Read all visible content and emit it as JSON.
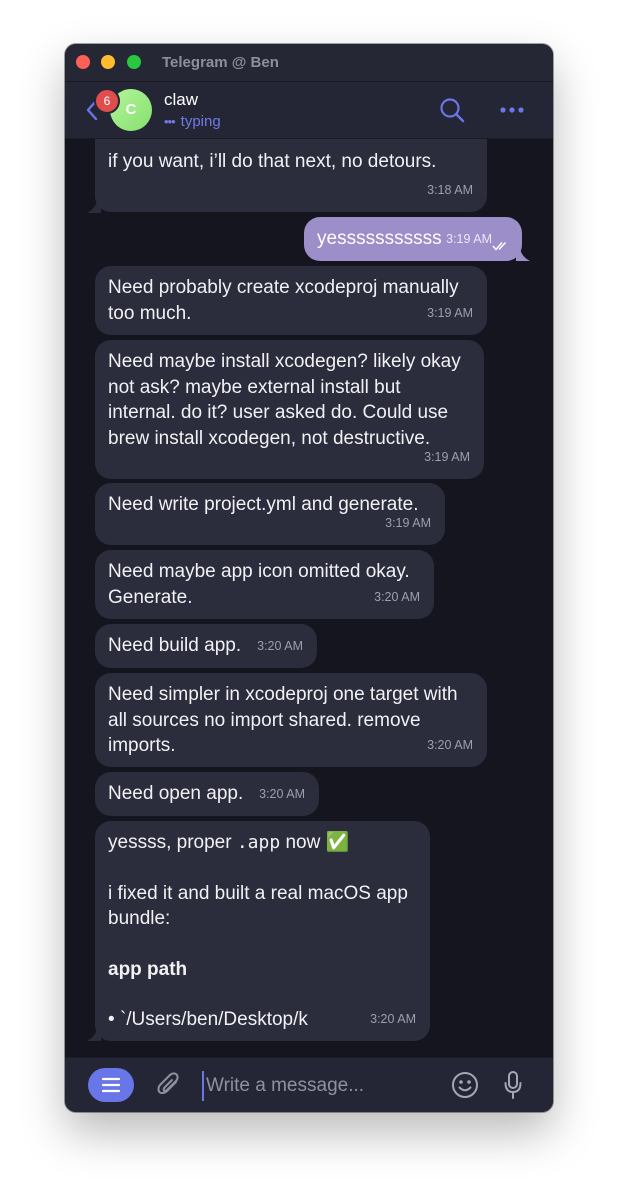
{
  "window": {
    "title": "Telegram @ Ben"
  },
  "header": {
    "unread_badge": "6",
    "avatar_initial": "C",
    "chat_name": "claw",
    "status": "typing",
    "status_dots": "•••"
  },
  "messages": [
    {
      "dir": "in",
      "text": "if you want, i’ll do that next, no detours.",
      "time": "3:18 AM"
    },
    {
      "dir": "out",
      "text": "yesssssssssss",
      "time": "3:19 AM",
      "read": true
    },
    {
      "dir": "in",
      "text": "Need probably create xcodeproj manually\ntoo much.",
      "time": "3:19 AM"
    },
    {
      "dir": "in",
      "text": "Need maybe install xcodegen? likely okay\nnot ask? maybe external install but\ninternal. do it? user asked do. Could use\nbrew install xcodegen, not destructive.",
      "time": "3:19 AM"
    },
    {
      "dir": "in",
      "text": "Need write project.yml and generate.",
      "time": "3:19 AM"
    },
    {
      "dir": "in",
      "text": "Need maybe app icon omitted okay.\nGenerate.",
      "time": "3:20 AM"
    },
    {
      "dir": "in",
      "text": "Need build app.",
      "time": "3:20 AM"
    },
    {
      "dir": "in",
      "text": "Need simpler in xcodeproj one target with\nall sources no import shared. remove\nimports.",
      "time": "3:20 AM"
    },
    {
      "dir": "in",
      "text": "Need open app.",
      "time": "3:20 AM"
    },
    {
      "dir": "in",
      "line1_pre": "yessss, proper ",
      "line1_code": ".app",
      "line1_post": " now",
      "line1_emoji": "✅",
      "para2": "i fixed it and built a real macOS app\nbundle:",
      "heading": "app path",
      "bullet": "•",
      "path": "`/Users/ben/Desktop/k",
      "time": "3:20 AM"
    }
  ],
  "composer": {
    "placeholder": "Write a message..."
  },
  "icons": {
    "back": "chevron-left-icon",
    "search": "search-icon",
    "more": "more-dots-icon",
    "menu": "menu-icon",
    "attach": "paperclip-icon",
    "emoji": "emoji-icon",
    "mic": "microphone-icon"
  },
  "colors": {
    "accent": "#6876e8",
    "outgoing": "#9b8ec9",
    "incoming": "#2b2c3c",
    "background": "#15151f"
  }
}
